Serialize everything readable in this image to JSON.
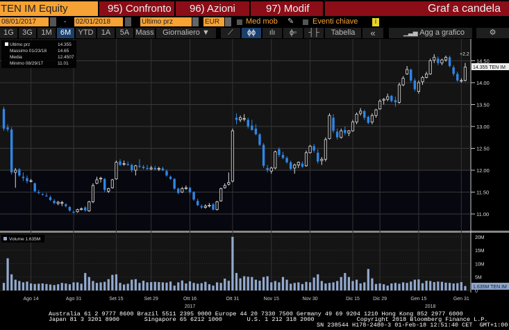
{
  "header": {
    "ticker": "TEN IM Equity",
    "compare": "95) Confronto",
    "actions": "96) Azioni",
    "modify": "97) Modif",
    "title": "Graf a candela"
  },
  "controls": {
    "start_date": "08/01/2017",
    "dash": "-",
    "end_date": "02/01/2018",
    "field": "Ultimo prz",
    "currency": "EUR",
    "moving_avg": "Med mob",
    "key_events": "Eventi chiave",
    "info": "i"
  },
  "toolbar": {
    "periods": [
      "1G",
      "3G",
      "1M",
      "6M",
      "YTD",
      "1A",
      "5A",
      "Mass"
    ],
    "selected_period": "6M",
    "frequency": "Giornaliero ▼",
    "table": "Tabella",
    "collapse": "«",
    "add_to_chart": "Agg a grafico",
    "settings": "⚙"
  },
  "colors": {
    "up": "#ffffff",
    "down": "#2f86e6",
    "volume": "#93a9cf",
    "ticker_bg": "#f7a234",
    "button_bg": "#8b0d18"
  },
  "chart_data": {
    "type": "candlestick",
    "legend": [
      {
        "label": "Ultimo prz",
        "value": "14.355"
      },
      {
        "label": "Massimo 01/23/18",
        "value": "14.65"
      },
      {
        "label": "Media",
        "value": "12.4507"
      },
      {
        "label": "Minimo 08/29/17",
        "value": "11.01"
      }
    ],
    "last_label": "14.355 TEN IM",
    "annotation": "+2.2",
    "price_ylim": [
      10.6,
      14.75
    ],
    "price_ticks": [
      "14.50",
      "14.00",
      "13.50",
      "13.00",
      "12.50",
      "12.00",
      "11.50",
      "11.00"
    ],
    "ohlc": [
      [
        13.4,
        13.45,
        12.9,
        12.95
      ],
      [
        12.98,
        13.05,
        12.88,
        12.93
      ],
      [
        12.93,
        12.98,
        11.9,
        11.95
      ],
      [
        11.95,
        12.05,
        11.6,
        12.0
      ],
      [
        12.02,
        12.05,
        11.85,
        11.88
      ],
      [
        11.85,
        11.95,
        11.75,
        11.82
      ],
      [
        11.82,
        11.88,
        11.7,
        11.75
      ],
      [
        11.76,
        11.8,
        11.72,
        11.76
      ],
      [
        11.7,
        11.72,
        11.5,
        11.52
      ],
      [
        11.5,
        11.55,
        11.45,
        11.48
      ],
      [
        11.45,
        11.48,
        11.42,
        11.44
      ],
      [
        11.42,
        11.48,
        11.4,
        11.4
      ],
      [
        11.38,
        11.42,
        11.3,
        11.32
      ],
      [
        11.3,
        11.34,
        11.22,
        11.25
      ],
      [
        11.24,
        11.3,
        11.2,
        11.27
      ],
      [
        11.26,
        11.3,
        11.18,
        11.26
      ],
      [
        11.22,
        11.25,
        11.15,
        11.18
      ],
      [
        11.16,
        11.18,
        11.05,
        11.08
      ],
      [
        11.05,
        11.08,
        11.01,
        11.03
      ],
      [
        11.05,
        11.12,
        11.03,
        11.1
      ],
      [
        11.1,
        11.15,
        11.08,
        11.12
      ],
      [
        11.15,
        11.18,
        11.05,
        11.08
      ],
      [
        11.07,
        11.3,
        11.05,
        11.28
      ],
      [
        11.28,
        11.7,
        11.25,
        11.65
      ],
      [
        11.7,
        11.85,
        11.68,
        11.78
      ],
      [
        11.8,
        11.85,
        11.72,
        11.82
      ],
      [
        11.8,
        11.82,
        11.5,
        11.55
      ],
      [
        11.52,
        11.6,
        11.48,
        11.58
      ],
      [
        11.6,
        11.8,
        11.58,
        11.78
      ],
      [
        11.8,
        12.22,
        11.78,
        12.18
      ],
      [
        12.2,
        12.25,
        12.1,
        12.12
      ],
      [
        12.15,
        12.22,
        12.1,
        12.15
      ],
      [
        12.14,
        12.2,
        12.1,
        12.12
      ],
      [
        12.12,
        12.15,
        11.95,
        12.0
      ],
      [
        12.0,
        12.12,
        11.88,
        12.1
      ],
      [
        12.1,
        12.25,
        12.05,
        12.08
      ],
      [
        12.08,
        12.12,
        12.02,
        12.05
      ],
      [
        12.05,
        12.12,
        12.0,
        12.03
      ],
      [
        12.03,
        12.1,
        12.0,
        12.05
      ],
      [
        12.05,
        12.1,
        12.0,
        12.02
      ],
      [
        12.03,
        12.08,
        11.98,
        12.04
      ],
      [
        12.04,
        12.08,
        11.98,
        12.0
      ],
      [
        11.98,
        12.02,
        11.85,
        11.88
      ],
      [
        11.85,
        11.88,
        11.78,
        11.8
      ],
      [
        11.8,
        11.82,
        11.55,
        11.58
      ],
      [
        11.58,
        11.6,
        11.45,
        11.48
      ],
      [
        11.5,
        11.62,
        11.48,
        11.58
      ],
      [
        11.58,
        11.65,
        11.55,
        11.6
      ],
      [
        11.6,
        11.62,
        11.45,
        11.5
      ],
      [
        11.5,
        11.52,
        11.3,
        11.33
      ],
      [
        11.3,
        11.35,
        11.18,
        11.2
      ],
      [
        11.18,
        11.22,
        11.12,
        11.15
      ],
      [
        11.15,
        11.22,
        11.12,
        11.18
      ],
      [
        11.18,
        11.25,
        11.15,
        11.2
      ],
      [
        11.22,
        11.25,
        11.08,
        11.1
      ],
      [
        11.1,
        11.3,
        11.08,
        11.28
      ],
      [
        11.3,
        11.6,
        11.28,
        11.58
      ],
      [
        11.6,
        11.7,
        11.58,
        11.65
      ],
      [
        11.68,
        11.95,
        11.65,
        11.72
      ],
      [
        11.75,
        12.95,
        11.72,
        12.9
      ],
      [
        13.2,
        13.3,
        13.05,
        13.15
      ],
      [
        13.15,
        13.25,
        13.1,
        13.2
      ],
      [
        13.18,
        13.28,
        13.12,
        13.18
      ],
      [
        13.15,
        13.2,
        12.95,
        13.0
      ],
      [
        13.02,
        13.15,
        12.9,
        12.92
      ],
      [
        12.95,
        13.05,
        12.8,
        12.82
      ],
      [
        12.82,
        12.85,
        12.55,
        12.58
      ],
      [
        12.58,
        12.62,
        12.05,
        12.1
      ],
      [
        12.05,
        12.12,
        11.95,
        12.0
      ],
      [
        11.98,
        12.08,
        11.92,
        12.05
      ],
      [
        12.05,
        12.45,
        12.02,
        12.42
      ],
      [
        12.48,
        12.52,
        12.3,
        12.35
      ],
      [
        12.35,
        12.42,
        12.25,
        12.28
      ],
      [
        12.28,
        12.32,
        12.15,
        12.18
      ],
      [
        12.18,
        12.22,
        12.0,
        12.03
      ],
      [
        12.05,
        12.15,
        11.92,
        12.12
      ],
      [
        12.12,
        12.2,
        12.05,
        12.18
      ],
      [
        12.15,
        12.2,
        12.05,
        12.08
      ],
      [
        12.1,
        12.45,
        12.08,
        12.4
      ],
      [
        12.4,
        12.58,
        12.38,
        12.55
      ],
      [
        12.55,
        12.6,
        12.4,
        12.45
      ],
      [
        12.4,
        12.48,
        12.15,
        12.2
      ],
      [
        12.22,
        12.3,
        12.12,
        12.25
      ],
      [
        12.25,
        12.75,
        12.2,
        12.7
      ],
      [
        12.72,
        13.3,
        12.7,
        13.25
      ],
      [
        13.2,
        13.28,
        12.85,
        12.9
      ],
      [
        12.88,
        12.95,
        12.7,
        12.75
      ],
      [
        12.75,
        12.95,
        12.72,
        12.9
      ],
      [
        12.92,
        13.0,
        12.8,
        12.85
      ],
      [
        12.85,
        12.92,
        12.78,
        12.9
      ],
      [
        12.9,
        13.15,
        12.88,
        13.1
      ],
      [
        13.1,
        13.32,
        13.05,
        13.28
      ],
      [
        13.3,
        13.42,
        13.25,
        13.35
      ],
      [
        13.35,
        13.38,
        13.15,
        13.2
      ],
      [
        13.22,
        13.25,
        13.05,
        13.08
      ],
      [
        13.1,
        13.3,
        13.05,
        13.25
      ],
      [
        13.25,
        13.4,
        13.2,
        13.38
      ],
      [
        13.4,
        13.62,
        13.38,
        13.58
      ],
      [
        13.6,
        13.65,
        13.5,
        13.62
      ],
      [
        13.62,
        13.75,
        13.58,
        13.68
      ],
      [
        13.7,
        13.72,
        13.55,
        13.58
      ],
      [
        13.6,
        13.68,
        13.45,
        13.55
      ],
      [
        13.55,
        14.0,
        13.52,
        13.95
      ],
      [
        13.95,
        14.15,
        13.92,
        14.1
      ],
      [
        14.2,
        14.38,
        14.18,
        14.3
      ],
      [
        14.3,
        14.32,
        14.0,
        14.05
      ],
      [
        14.05,
        14.1,
        13.8,
        13.85
      ],
      [
        13.8,
        14.05,
        13.75,
        14.0
      ],
      [
        14.02,
        14.15,
        13.95,
        14.12
      ],
      [
        14.12,
        14.25,
        14.1,
        14.2
      ],
      [
        14.2,
        14.55,
        14.18,
        14.5
      ],
      [
        14.52,
        14.65,
        14.45,
        14.58
      ],
      [
        14.55,
        14.6,
        14.4,
        14.45
      ],
      [
        14.45,
        14.55,
        14.4,
        14.52
      ],
      [
        14.52,
        14.62,
        14.48,
        14.58
      ],
      [
        14.58,
        14.62,
        14.35,
        14.38
      ],
      [
        14.35,
        14.4,
        14.15,
        14.2
      ],
      [
        14.2,
        14.25,
        14.02,
        14.05
      ],
      [
        14.05,
        14.1,
        14.0,
        14.05
      ],
      [
        14.05,
        14.45,
        14.03,
        14.355
      ]
    ],
    "volume_legend": "Volume 1.635M",
    "volume_last_label": "1.635M TEN IM",
    "volume_ylim": [
      0,
      21
    ],
    "volume_ticks": [
      "20M",
      "15M",
      "10M",
      "5M",
      "0"
    ],
    "volume_millions": [
      2.8,
      12,
      6,
      4,
      3.5,
      3,
      3.3,
      2.6,
      2.4,
      2.5,
      2.6,
      2.4,
      2.2,
      2,
      2.3,
      2.8,
      2.6,
      2.3,
      3,
      3,
      2.5,
      6.5,
      5,
      3.5,
      2.8,
      3,
      3.2,
      4.2,
      5.8,
      6,
      2.8,
      2.2,
      2.5,
      4,
      4.2,
      2.8,
      3.6,
      3,
      3.1,
      3.2,
      3.1,
      3,
      2.9,
      3.3,
      1.8,
      3,
      3.7,
      2.6,
      3.4,
      2.8,
      2.5,
      2.7,
      3.2,
      2.3,
      1.8,
      3,
      2.8,
      4.4,
      3.6,
      20,
      6.5,
      4.5,
      5.3,
      5.1,
      5,
      4,
      3.6,
      5,
      5.3,
      3,
      3.5,
      3,
      5,
      4,
      2.5,
      2.8,
      3,
      2.4,
      3.2,
      3,
      4.8,
      6,
      3.5,
      2.6,
      2.8,
      3,
      3.5,
      5,
      6.5,
      5,
      3.5,
      4,
      2.6,
      3,
      8,
      4.5,
      2.4,
      2.6,
      2.3,
      1.8,
      2.6,
      2.8,
      2.5,
      3,
      2.8,
      3.3,
      4,
      4.1,
      2.7,
      3.6,
      3.5,
      3.1,
      3.3,
      3.2,
      2.9,
      2.8,
      2.6,
      2.7,
      3.1,
      1.635
    ],
    "x_ticks": [
      {
        "i": 7,
        "label": "Ago 14"
      },
      {
        "i": 18,
        "label": "Ago 31"
      },
      {
        "i": 29,
        "label": "Set 15"
      },
      {
        "i": 38,
        "label": "Set 29"
      },
      {
        "i": 48,
        "label": "Ott 16"
      },
      {
        "i": 59,
        "label": "Ott 31"
      },
      {
        "i": 69,
        "label": "Nov 15"
      },
      {
        "i": 79,
        "label": "Nov 30"
      },
      {
        "i": 90,
        "label": "Dic 15"
      },
      {
        "i": 97,
        "label": "Dic 29"
      },
      {
        "i": 107,
        "label": "Gen 15"
      },
      {
        "i": 118,
        "label": "Gen 31"
      }
    ],
    "years": [
      {
        "i": 48,
        "label": "2017"
      },
      {
        "i": 110,
        "label": "2018"
      }
    ]
  },
  "footer": {
    "line1": "Australia 61 2 9777 8600 Brazil 5511 2395 9000 Europe 44 20 7330 7500 Germany 49 69 9204 1210 Hong Kong 852 2977 6000",
    "line2": "Japan 81 3 3201 8900       Singapore 65 6212 1000       U.S. 1 212 318 2000            Copyright 2018 Bloomberg Finance L.P.",
    "line3": "SN 238544 H178-2480-3 01-Feb-18 12:51:40 CET  GMT+1:00"
  }
}
